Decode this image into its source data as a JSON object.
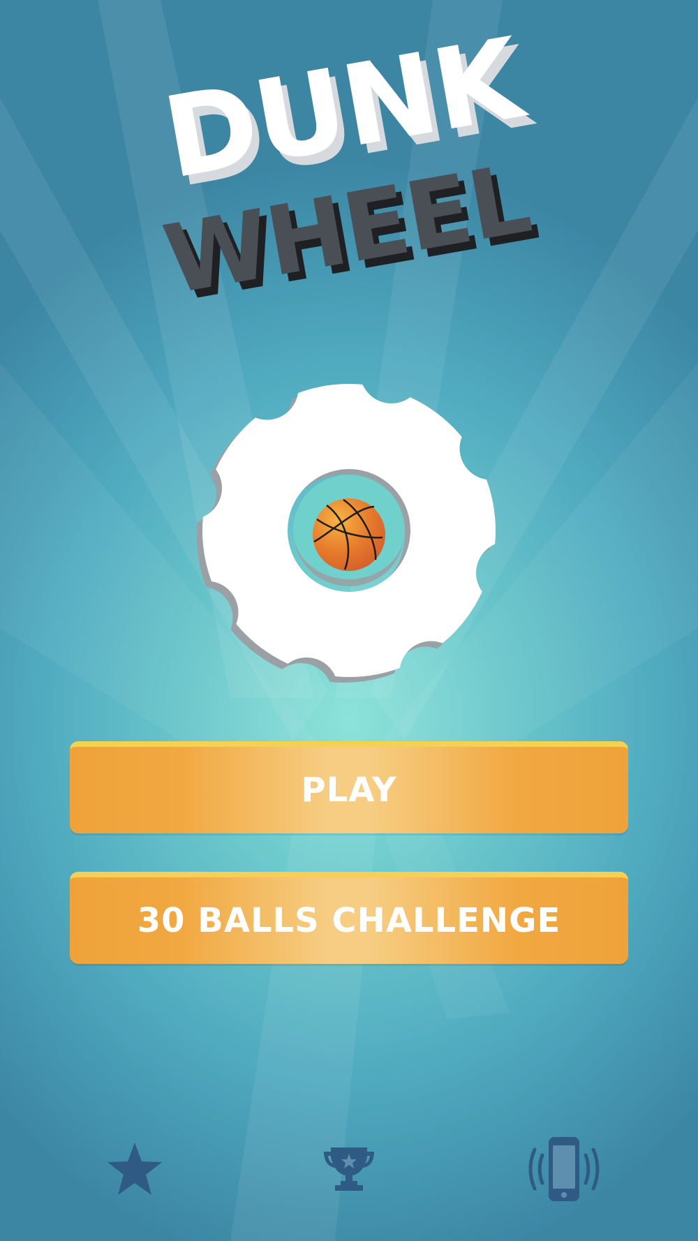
{
  "title": {
    "line1": "DUNK",
    "line2": "WHEEL"
  },
  "wheel": {
    "center_ball": "basketball-icon"
  },
  "buttons": {
    "play_label": "PLAY",
    "challenge_label": "30 BALLS CHALLENGE"
  },
  "bottom_bar": {
    "icons": [
      "star-icon",
      "trophy-icon",
      "vibration-phone-icon"
    ]
  },
  "colors": {
    "button_orange": "#f0a23a",
    "button_highlight": "#f6cd82",
    "button_top_edge": "#f5d152",
    "title_white": "#ffffff",
    "title_dark": "#4a4e55",
    "icon_navy": "#2f5a84",
    "ball_orange": "#e6782c"
  }
}
